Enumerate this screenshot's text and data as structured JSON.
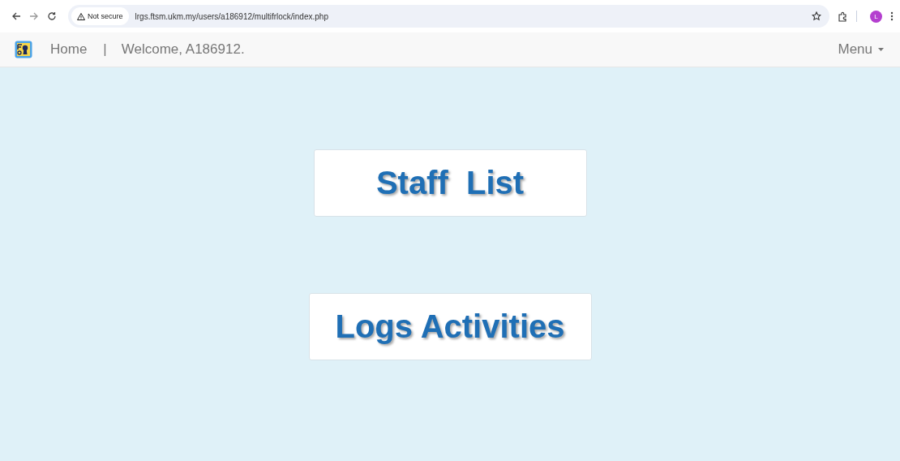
{
  "browser": {
    "security_label": "Not secure",
    "url": "lrgs.ftsm.ukm.my/users/a186912/multifrlock/index.php",
    "profile_initial": "L"
  },
  "navbar": {
    "home": "Home",
    "separator": "|",
    "welcome": "Welcome, A186912.",
    "menu": "Menu"
  },
  "tiles": [
    {
      "label": "Staff  List"
    },
    {
      "label": "Logs Activities"
    }
  ]
}
